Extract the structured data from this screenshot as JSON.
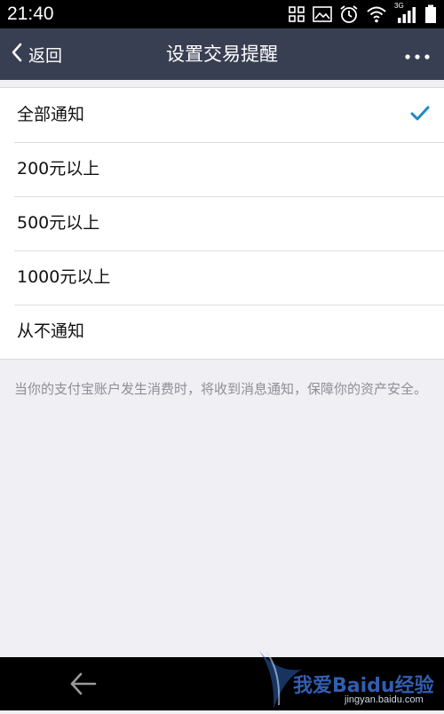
{
  "status_bar": {
    "time": "21:40",
    "signal_label": "3G",
    "icons": [
      "grid-icon",
      "image-icon",
      "alarm-icon",
      "wifi-icon",
      "signal-icon",
      "battery-icon"
    ]
  },
  "nav": {
    "back_label": "返回",
    "title": "设置交易提醒",
    "bar_color": "#393f52"
  },
  "options": [
    {
      "label": "全部通知",
      "selected": true
    },
    {
      "label": "200元以上",
      "selected": false
    },
    {
      "label": "500元以上",
      "selected": false
    },
    {
      "label": "1000元以上",
      "selected": false
    },
    {
      "label": "从不通知",
      "selected": false
    }
  ],
  "footnote": "当你的支付宝账户发生消费时，将收到消息通知，保障你的资产安全。",
  "watermark": {
    "text": "我爱Baidu经验",
    "url": "jingyan.baidu.com"
  },
  "colors": {
    "accent_check": "#1e88c8",
    "background": "#efeff4"
  }
}
